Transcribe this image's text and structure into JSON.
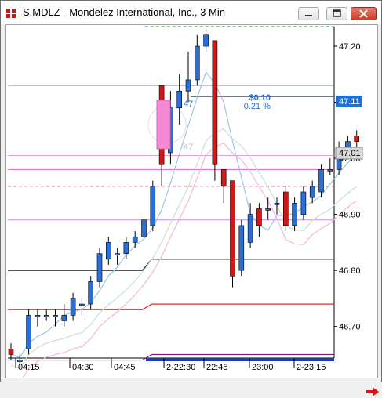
{
  "window": {
    "title": "S.MDLZ - Mondelez International, Inc., 3 Min",
    "buttons": [
      "minimize",
      "maximize",
      "close"
    ]
  },
  "price_axis": {
    "ticks": [
      "47.20",
      "47.10",
      "47.00",
      "46.90",
      "46.80",
      "46.70"
    ],
    "current_price_label": "47.11",
    "last_price_label": "47.01"
  },
  "time_axis": {
    "ticks": [
      "04:15",
      "04:30",
      "04:45",
      "2-22:30",
      "22:45",
      "23:00",
      "2-23:15"
    ]
  },
  "measure": {
    "amount": "$0.10",
    "percent": "0.21 %",
    "start_label": "47",
    "end_label": "47"
  },
  "chart_data": {
    "type": "candlestick",
    "title": "S.MDLZ - Mondelez International, Inc., 3 Min",
    "ylim": [
      46.645,
      47.235
    ],
    "colors": {
      "up": "#2a6fd6",
      "down": "#d01818"
    },
    "candles": [
      {
        "o": 46.66,
        "h": 46.67,
        "l": 46.64,
        "c": 46.65
      },
      {
        "o": 46.64,
        "h": 46.65,
        "l": 46.63,
        "c": 46.64
      },
      {
        "o": 46.66,
        "h": 46.73,
        "l": 46.65,
        "c": 46.72
      },
      {
        "o": 46.72,
        "h": 46.73,
        "l": 46.7,
        "c": 46.72
      },
      {
        "o": 46.72,
        "h": 46.73,
        "l": 46.71,
        "c": 46.72
      },
      {
        "o": 46.72,
        "h": 46.73,
        "l": 46.7,
        "c": 46.72
      },
      {
        "o": 46.71,
        "h": 46.74,
        "l": 46.7,
        "c": 46.72
      },
      {
        "o": 46.72,
        "h": 46.76,
        "l": 46.71,
        "c": 46.75
      },
      {
        "o": 46.74,
        "h": 46.75,
        "l": 46.72,
        "c": 46.74
      },
      {
        "o": 46.74,
        "h": 46.79,
        "l": 46.73,
        "c": 46.78
      },
      {
        "o": 46.78,
        "h": 46.84,
        "l": 46.77,
        "c": 46.83
      },
      {
        "o": 46.82,
        "h": 46.86,
        "l": 46.81,
        "c": 46.85
      },
      {
        "o": 46.83,
        "h": 46.84,
        "l": 46.81,
        "c": 46.83
      },
      {
        "o": 46.83,
        "h": 46.86,
        "l": 46.82,
        "c": 46.85
      },
      {
        "o": 46.85,
        "h": 46.87,
        "l": 46.84,
        "c": 46.86
      },
      {
        "o": 46.86,
        "h": 46.9,
        "l": 46.85,
        "c": 46.89
      },
      {
        "o": 46.88,
        "h": 46.96,
        "l": 46.87,
        "c": 46.95
      },
      {
        "o": 47.13,
        "h": 47.13,
        "l": 46.95,
        "c": 46.99
      },
      {
        "o": 47.01,
        "h": 47.12,
        "l": 46.99,
        "c": 47.09
      },
      {
        "o": 47.09,
        "h": 47.15,
        "l": 47.06,
        "c": 47.12
      },
      {
        "o": 47.12,
        "h": 47.19,
        "l": 47.1,
        "c": 47.14
      },
      {
        "o": 47.14,
        "h": 47.22,
        "l": 47.13,
        "c": 47.2
      },
      {
        "o": 47.2,
        "h": 47.23,
        "l": 47.19,
        "c": 47.22
      },
      {
        "o": 47.21,
        "h": 47.21,
        "l": 46.96,
        "c": 46.99
      },
      {
        "o": 46.98,
        "h": 46.98,
        "l": 46.92,
        "c": 46.95
      },
      {
        "o": 46.96,
        "h": 46.96,
        "l": 46.77,
        "c": 46.79
      },
      {
        "o": 46.8,
        "h": 46.89,
        "l": 46.79,
        "c": 46.88
      },
      {
        "o": 46.85,
        "h": 46.92,
        "l": 46.84,
        "c": 46.9
      },
      {
        "o": 46.91,
        "h": 46.92,
        "l": 46.86,
        "c": 46.88
      },
      {
        "o": 46.91,
        "h": 46.93,
        "l": 46.89,
        "c": 46.91
      },
      {
        "o": 46.92,
        "h": 46.93,
        "l": 46.9,
        "c": 46.92
      },
      {
        "o": 46.94,
        "h": 46.95,
        "l": 46.87,
        "c": 46.88
      },
      {
        "o": 46.88,
        "h": 46.93,
        "l": 46.87,
        "c": 46.92
      },
      {
        "o": 46.9,
        "h": 46.95,
        "l": 46.89,
        "c": 46.94
      },
      {
        "o": 46.93,
        "h": 46.96,
        "l": 46.92,
        "c": 46.95
      },
      {
        "o": 46.94,
        "h": 46.99,
        "l": 46.93,
        "c": 46.98
      },
      {
        "o": 46.98,
        "h": 47.0,
        "l": 46.97,
        "c": 46.98
      },
      {
        "o": 46.98,
        "h": 47.03,
        "l": 46.97,
        "c": 47.02
      },
      {
        "o": 47.02,
        "h": 47.04,
        "l": 47.01,
        "c": 47.03
      },
      {
        "o": 47.04,
        "h": 47.05,
        "l": 47.02,
        "c": 47.03
      }
    ],
    "horizontal_lines": [
      {
        "y": 47.235,
        "color": "#1a9a3a",
        "style": "dashed",
        "from": 0.42
      },
      {
        "y": 47.13,
        "color": "#9a9a9a",
        "style": "solid",
        "from": 0
      },
      {
        "y": 47.11,
        "color": "#1f6fd6",
        "style": "solid",
        "from": 0.56
      },
      {
        "y": 47.005,
        "color": "#e8a0d8",
        "style": "solid",
        "from": 0
      },
      {
        "y": 46.98,
        "color": "#e85fb5",
        "style": "solid",
        "from": 0
      },
      {
        "y": 46.95,
        "color": "#e85fb5",
        "style": "dashed",
        "from": 0
      },
      {
        "y": 46.89,
        "color": "#c88ee6",
        "style": "solid",
        "from": 0
      },
      {
        "y": 46.82,
        "color": "#1a1a1a",
        "style": "step",
        "from": 0,
        "prev": 46.8
      },
      {
        "y": 46.74,
        "color": "#d01818",
        "style": "step",
        "from": 0,
        "prev": 46.73
      },
      {
        "y": 46.65,
        "color": "#7a1a7a",
        "style": "step",
        "from": 0,
        "prev": 46.64
      }
    ]
  }
}
